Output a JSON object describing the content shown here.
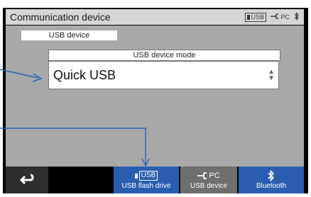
{
  "titlebar": {
    "title": "Communication device",
    "status_usb": "USB",
    "status_pc": "PC"
  },
  "section": {
    "header": "USB device",
    "mode_label": "USB device mode",
    "mode_value": "Quick USB"
  },
  "bottom_tabs": [
    {
      "label": "USB flash drive",
      "icon_text": "USB",
      "active": true
    },
    {
      "label": "USB device",
      "icon_text": "PC",
      "active": false
    },
    {
      "label": "Bluetooth",
      "icon_text": "",
      "active": false
    }
  ],
  "colors": {
    "tab_blue": "#2a5db0",
    "tab_gray": "#6e6e6e",
    "panel_gray": "#a9a9a9",
    "callout": "#2f67b5"
  },
  "icons": {
    "back": "return-arrow-icon",
    "bluetooth": "bluetooth-icon",
    "usb": "usb-icon",
    "pc": "pc-connection-icon"
  }
}
